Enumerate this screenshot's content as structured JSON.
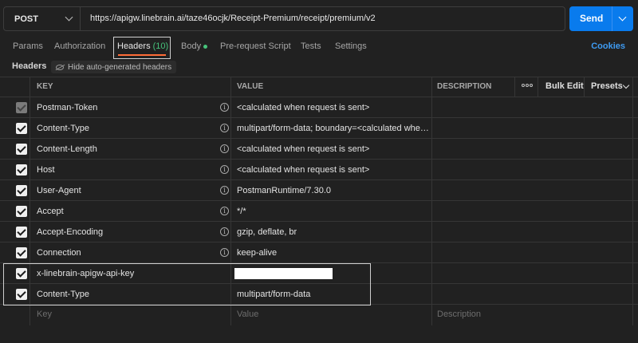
{
  "request": {
    "method": "POST",
    "url": "https://apigw.linebrain.ai/taze46ocjk/Receipt-Premium/receipt/premium/v2",
    "send_label": "Send"
  },
  "tabs": {
    "params": "Params",
    "authorization": "Authorization",
    "headers": "Headers",
    "headers_count": "(10)",
    "body": "Body",
    "prerequest": "Pre-request Script",
    "tests": "Tests",
    "settings": "Settings",
    "cookies": "Cookies"
  },
  "subheader": {
    "label": "Headers",
    "hide_auto": "Hide auto-generated headers"
  },
  "table": {
    "col_key": "KEY",
    "col_value": "VALUE",
    "col_description": "DESCRIPTION",
    "bulk_edit": "Bulk Edit",
    "presets": "Presets",
    "rows": [
      {
        "key": "Postman-Token",
        "value": "<calculated when request is sent>",
        "auto": true,
        "disabled": true
      },
      {
        "key": "Content-Type",
        "value": "multipart/form-data; boundary=<calculated when re...",
        "auto": true
      },
      {
        "key": "Content-Length",
        "value": "<calculated when request is sent>",
        "auto": true
      },
      {
        "key": "Host",
        "value": "<calculated when request is sent>",
        "auto": true
      },
      {
        "key": "User-Agent",
        "value": "PostmanRuntime/7.30.0",
        "auto": true
      },
      {
        "key": "Accept",
        "value": "*/*",
        "auto": true
      },
      {
        "key": "Accept-Encoding",
        "value": "gzip, deflate, br",
        "auto": true
      },
      {
        "key": "Connection",
        "value": "keep-alive",
        "auto": true
      },
      {
        "key": "x-linebrain-apigw-api-key",
        "value": "",
        "auto": false,
        "redacted": true
      },
      {
        "key": "Content-Type",
        "value": "multipart/form-data",
        "auto": false
      }
    ],
    "placeholder_key": "Key",
    "placeholder_value": "Value",
    "placeholder_description": "Description"
  }
}
